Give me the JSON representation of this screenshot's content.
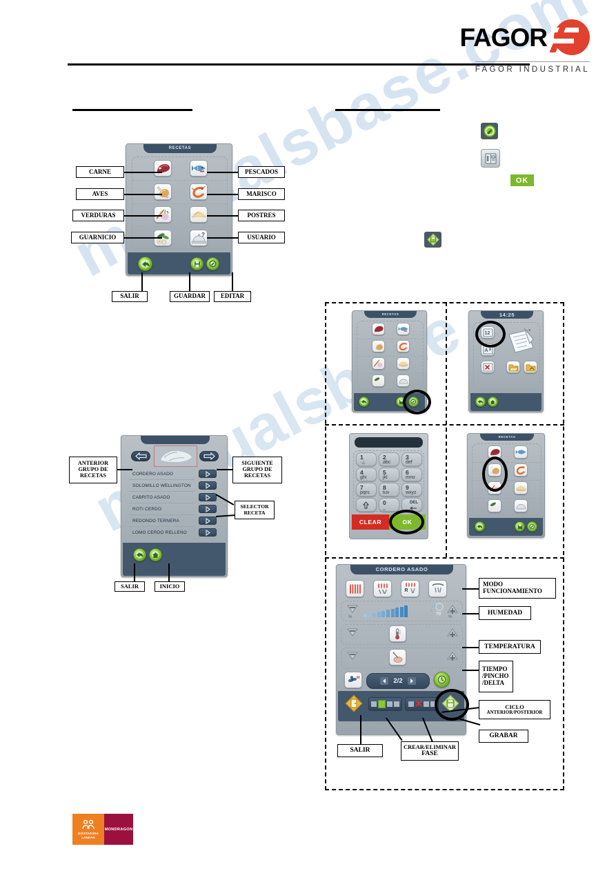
{
  "brand": {
    "name": "FAGOR",
    "tagline": "FAGOR INDUSTRIAL"
  },
  "footer_logo": {
    "left_line1": "GIZATASUNA",
    "left_line2": "LANEAN",
    "right": "MONDRAGON"
  },
  "recipes_screen": {
    "title": "RECETAS",
    "categories_left": [
      {
        "label": "CARNE",
        "icon": "meat-steak-icon"
      },
      {
        "label": "AVES",
        "icon": "poultry-chicken-icon"
      },
      {
        "label": "VERDURAS",
        "icon": "vegetables-icon"
      },
      {
        "label": "GUARNICIO",
        "icon": "garnish-icon"
      }
    ],
    "categories_right": [
      {
        "label": "PESCADOS",
        "icon": "fish-icon"
      },
      {
        "label": "MARISCO",
        "icon": "shrimp-icon"
      },
      {
        "label": "POSTRES",
        "icon": "dessert-pie-icon"
      },
      {
        "label": "USUARIO",
        "icon": "user-cloche-icon"
      }
    ],
    "footer_buttons": [
      {
        "label": "SALIR",
        "icon": "back-arrow-icon"
      },
      {
        "label": "GUARDAR",
        "icon": "save-disk-icon"
      },
      {
        "label": "EDITAR",
        "icon": "edit-icon"
      }
    ]
  },
  "recipe_list_screen": {
    "prev_group_label": "ANTERIOR GRUPO DE RECETAS",
    "next_group_label": "SIGUIENTE GRUPO DE RECETAS",
    "selector_label": "SELECTOR RECETA",
    "items": [
      "CORDERO ASADO",
      "SOLOMILLO WELLINGTON",
      "CABRITO ASADO",
      "ROTI CERDO",
      "REDONDO TERNERA",
      "LOMO CERDO RELLENO"
    ],
    "footer_buttons": [
      {
        "label": "SALIR",
        "icon": "back-arrow-icon"
      },
      {
        "label": "INICIO",
        "icon": "home-icon"
      }
    ]
  },
  "right_icons": {
    "edit_icon": "edit-green-icon",
    "recipe_book_icon": "recipe-book-icon",
    "ok_button": "OK",
    "save_icon": "save-diamond-icon"
  },
  "flow_panels": {
    "panel1": {
      "title": "RECETAS",
      "highlight": "edit-button-highlight"
    },
    "panel2": {
      "clock": "14:25",
      "buttons": [
        "numeric-keypad-icon",
        "alpha-keypad-icon",
        "delete-icon",
        "folder-open-icon",
        "folder-save-icon"
      ],
      "highlight": "numeric-keypad-highlight"
    },
    "panel3": {
      "display_value": "",
      "keys": [
        {
          "num": "1",
          "sub": "·,¡"
        },
        {
          "num": "2",
          "sub": "abc"
        },
        {
          "num": "3",
          "sub": "def"
        },
        {
          "num": "4",
          "sub": "ghi"
        },
        {
          "num": "5",
          "sub": "jkl"
        },
        {
          "num": "6",
          "sub": "mno"
        },
        {
          "num": "7",
          "sub": "pqrs"
        },
        {
          "num": "8",
          "sub": "tuv"
        },
        {
          "num": "9",
          "sub": "wxyz"
        },
        {
          "num": "",
          "sub": ""
        },
        {
          "num": "0",
          "sub": "_"
        },
        {
          "num": "DEL",
          "sub": ""
        }
      ],
      "clear_label": "CLEAR",
      "ok_label": "OK",
      "highlight": "ok-key-highlight"
    },
    "panel4": {
      "title": "RECETAS",
      "highlight": "poultry-tile-highlight"
    }
  },
  "detail_screen": {
    "title": "CORDERO ASADO",
    "mode_label": "MODO FUNCIONAMIENTO",
    "mode_line1": "MODO",
    "mode_line2": "FUNCIONAMIENTO",
    "humidity_label": "HUMEDAD",
    "humidity_value": "70",
    "temperature_label": "TEMPERATURA",
    "time_label_line1": "TIEMPO",
    "time_label_line2": "/PINCHO",
    "time_label_line3": "/DELTA",
    "cycle_label_line1": "CICLO",
    "cycle_label_line2": "ANTERIOR/POSTERIOR",
    "record_label": "GRABAR",
    "exit_label": "SALIR",
    "phase_label_line1": "CREAR/ELIMINAR",
    "phase_label_line2": "FASE",
    "page_indicator": "2/2",
    "modes": [
      "convection-icon",
      "steam-convection-icon",
      "regen-icon",
      "steam-icon"
    ]
  },
  "colors": {
    "brand_red": "#e1412e",
    "green": "#8cc63f",
    "panel_blue": "#3c5166",
    "panel_grey": "#a9b2b9",
    "orange": "#ef8022",
    "maroon": "#9c1040"
  }
}
